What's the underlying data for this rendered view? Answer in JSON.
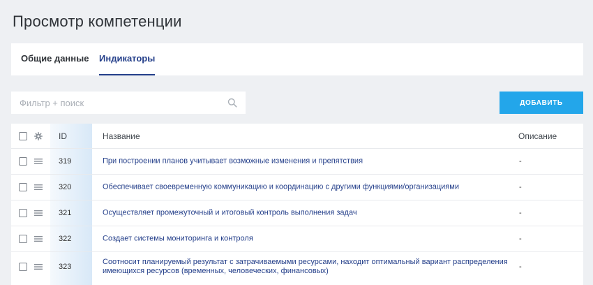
{
  "page": {
    "title": "Просмотр компетенции"
  },
  "tabs": [
    {
      "label": "Общие данные",
      "active": false
    },
    {
      "label": "Индикаторы",
      "active": true
    }
  ],
  "search": {
    "placeholder": "Фильтр + поиск",
    "value": ""
  },
  "toolbar": {
    "add_label": "ДОБАВИТЬ"
  },
  "colors": {
    "accent": "#243f8a",
    "button": "#23a6ea",
    "background": "#eef0f3"
  },
  "table": {
    "columns": {
      "id": "ID",
      "name": "Название",
      "description": "Описание"
    },
    "rows": [
      {
        "id": "319",
        "name": "При построении планов учитывает возможные изменения и препятствия",
        "name2": "",
        "description": "-"
      },
      {
        "id": "320",
        "name": "Обеспечивает своевременную коммуникацию и координацию с другими функциями/организациями",
        "name2": "",
        "description": "-"
      },
      {
        "id": "321",
        "name": "Осуществляет промежуточный и итоговый контроль выполнения задач",
        "name2": "",
        "description": "-"
      },
      {
        "id": "322",
        "name": "Создает системы мониторинга и контроля",
        "name2": "",
        "description": "-"
      },
      {
        "id": "323",
        "name": "Соотносит планируемый результат с затрачиваемыми ресурсами, находит оптимальный вариант распределения",
        "name2": "имеющихся ресурсов (временных, человеческих, финансовых)",
        "description": "-"
      }
    ]
  }
}
